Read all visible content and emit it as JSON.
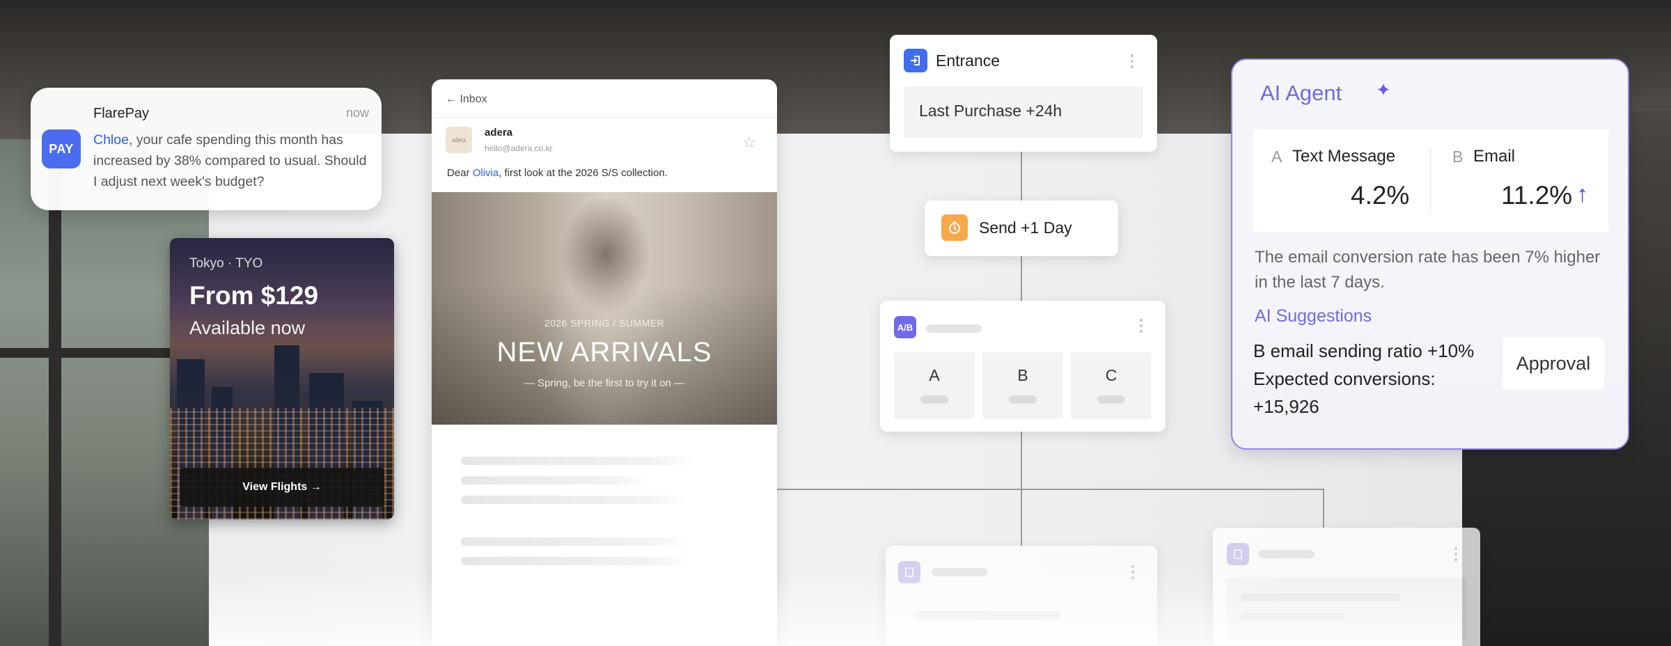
{
  "notification": {
    "icon_label": "PAY",
    "app": "FlarePay",
    "time": "now",
    "highlight_name": "Chloe",
    "message": ", your cafe spending this month has increased by 38% compared to usual. Should I adjust next week's budget?"
  },
  "flight_ad": {
    "city": "Tokyo · TYO",
    "price": "From $129",
    "availability": "Available now",
    "button": "View Flights →"
  },
  "email": {
    "back_label": "← Inbox",
    "avatar_text": "adera",
    "sender": "adera",
    "address": "hello@adera.co.kr",
    "star_icon": "☆",
    "greeting_prefix": "Dear ",
    "greeting_name": "Olivia",
    "greeting_suffix": ", first look at the 2026 S/S collection.",
    "season": "2026 SPRING / SUMMER",
    "headline": "NEW ARRIVALS",
    "tagline": "— Spring, be the first to try it on —"
  },
  "flow": {
    "entrance": {
      "title": "Entrance",
      "condition": "Last Purchase +24h",
      "icon": "entrance-icon"
    },
    "delay": {
      "title": "Send +1 Day",
      "icon": "timer-icon"
    },
    "split": {
      "icon": "ab-split-icon",
      "variants": [
        "A",
        "B",
        "C"
      ]
    }
  },
  "agent": {
    "title": "AI Agent",
    "sparkle": "✦",
    "channel_a_letter": "A",
    "channel_a": "Text Message",
    "value_a": "4.2%",
    "channel_b_letter": "B",
    "channel_b": "Email",
    "value_b": "11.2%",
    "trend_icon": "↑",
    "description": "The email conversion rate has been 7% higher in the last 7 days.",
    "suggestions_title": "AI Suggestions",
    "suggestion_line1": "B email sending ratio +10%",
    "suggestion_line2": "Expected conversions: +15,926",
    "approve_button": "Approval"
  },
  "colors": {
    "accent_blue": "#4b6cf0",
    "agent_purple": "#6d6ce0",
    "link_blue": "#2a62d8"
  }
}
